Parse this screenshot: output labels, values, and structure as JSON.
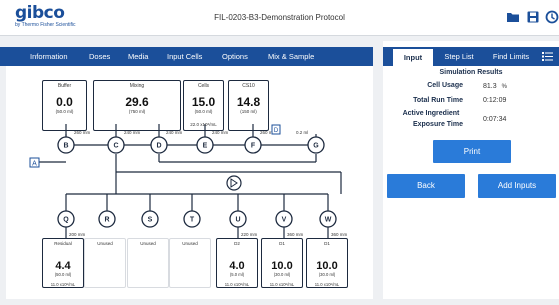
{
  "header": {
    "logo_text": "gibco",
    "logo_subtext": "by Thermo Fisher Scientific",
    "title": "FIL-0203-B3-Demonstration Protocol",
    "icons": [
      "folder-icon",
      "save-icon",
      "refresh-icon"
    ]
  },
  "nav": {
    "items": [
      "Information",
      "Doses",
      "Media",
      "Input Cells",
      "Options",
      "Mix & Sample"
    ]
  },
  "diagram": {
    "top_containers": [
      {
        "name": "Buffer",
        "value": "0.0",
        "volume": "(50.0 ml)",
        "conc": ""
      },
      {
        "name": "Mixing",
        "value": "29.6",
        "volume": "(750 ml)",
        "conc": ""
      },
      {
        "name": "Cells",
        "value": "15.0",
        "volume": "(50.0 ml)",
        "conc": "22.0 x10⁶/mL"
      },
      {
        "name": "CS10",
        "value": "14.8",
        "volume": "(150 ml)",
        "conc": ""
      }
    ],
    "top_valves": [
      {
        "id": "B",
        "length": "260 mm"
      },
      {
        "id": "C",
        "length": "240 mm"
      },
      {
        "id": "D",
        "length": "240 mm"
      },
      {
        "id": "E",
        "length": "240 mm"
      },
      {
        "id": "F",
        "length": "260 mm"
      },
      {
        "id": "G",
        "length": "0.2 ml"
      }
    ],
    "side_valve": "A",
    "filter_label": "D",
    "bottom_valves": [
      {
        "id": "Q",
        "length": "200 mm"
      },
      {
        "id": "R",
        "length": ""
      },
      {
        "id": "S",
        "length": ""
      },
      {
        "id": "T",
        "length": ""
      },
      {
        "id": "U",
        "length": "220 mm"
      },
      {
        "id": "V",
        "length": "360 mm"
      },
      {
        "id": "W",
        "length": "360 mm"
      }
    ],
    "bottom_containers": [
      {
        "name": "Residual",
        "value": "4.4",
        "volume": "(50.0 ml)",
        "conc": "11.0 x10⁶/mL",
        "used": true
      },
      {
        "name": "Unused",
        "value": "",
        "volume": "",
        "conc": "",
        "used": false
      },
      {
        "name": "Unused",
        "value": "",
        "volume": "",
        "conc": "",
        "used": false
      },
      {
        "name": "Unused",
        "value": "",
        "volume": "",
        "conc": "",
        "used": false
      },
      {
        "name": "D2",
        "value": "4.0",
        "volume": "(5.0 ml)",
        "conc": "11.0 x10⁶/mL",
        "used": true
      },
      {
        "name": "D1",
        "value": "10.0",
        "volume": "(30.0 ml)",
        "conc": "11.0 x10⁶/mL",
        "used": true
      },
      {
        "name": "D1",
        "value": "10.0",
        "volume": "(30.0 ml)",
        "conc": "11.0 x10⁶/mL",
        "used": true
      }
    ]
  },
  "panel": {
    "tabs": [
      "Input",
      "Step List",
      "Find Limits"
    ],
    "active_tab": "Input",
    "menu_icon": "list-icon",
    "sim_title": "Simulation Results",
    "cell_usage_label": "Cell Usage",
    "cell_usage_value": "81.3",
    "cell_usage_unit": "%",
    "run_time_label": "Total Run Time",
    "run_time_value": "0:12:09",
    "exposure_label_1": "Active Ingredient",
    "exposure_label_2": "Exposure Time",
    "exposure_value": "0:07:34",
    "print_label": "Print",
    "back_label": "Back",
    "add_inputs_label": "Add Inputs"
  },
  "colors": {
    "brand_blue": "#1b4f9a",
    "button_blue": "#2a7bd9",
    "dark_outline": "#1d2a3f"
  }
}
